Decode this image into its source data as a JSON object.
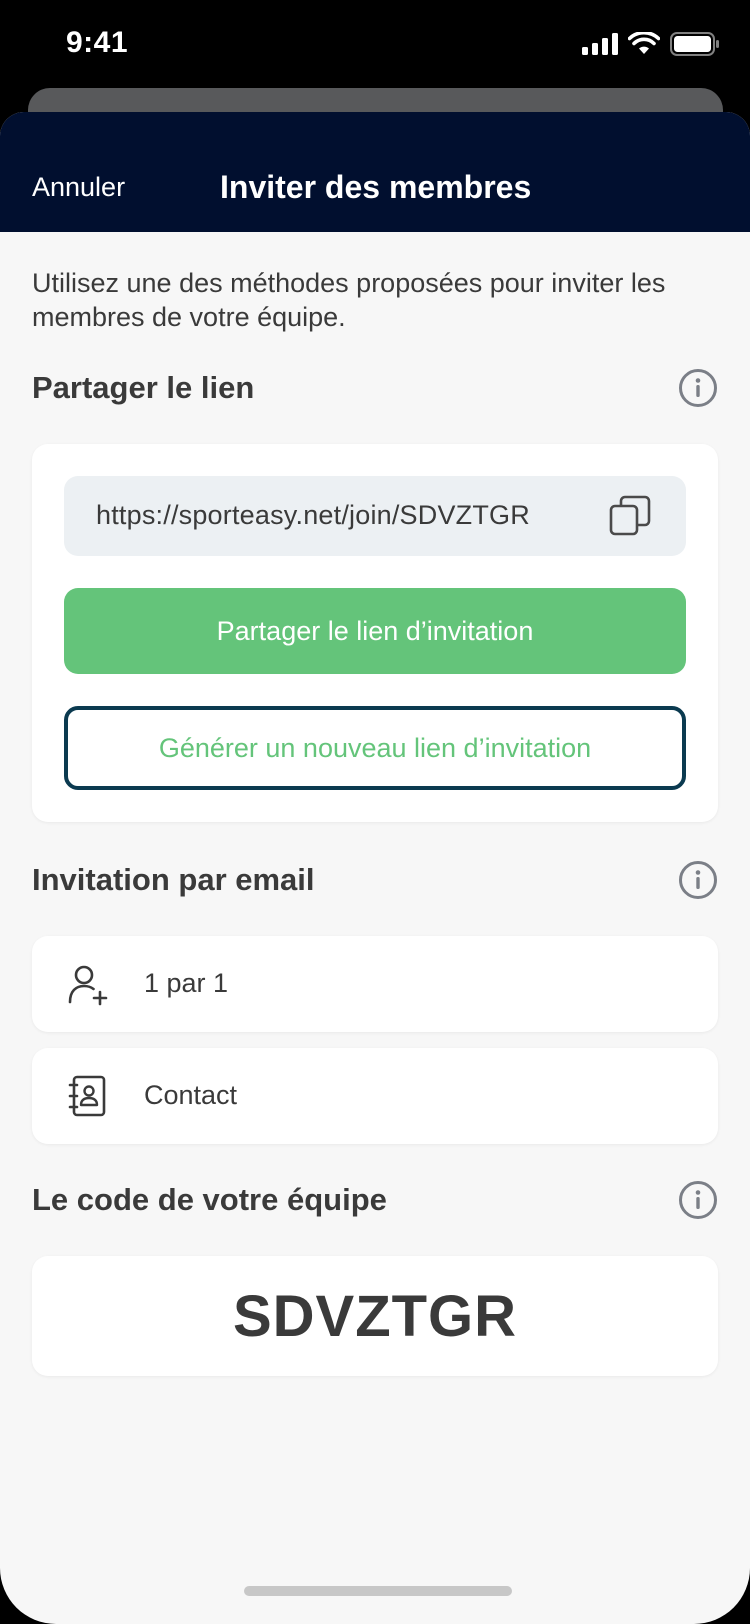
{
  "status_bar": {
    "time": "9:41",
    "icons": [
      "signal-icon",
      "wifi-icon",
      "battery-icon"
    ]
  },
  "nav": {
    "cancel_label": "Annuler",
    "title": "Inviter des membres"
  },
  "intro_text": "Utilisez une des méthodes proposées pour inviter les membres de votre équipe.",
  "share_section": {
    "title": "Partager le lien",
    "link": "https://sporteasy.net/join/SDVZTGR",
    "share_button": "Partager le lien d’invitation",
    "regenerate_button": "Générer un nouveau lien d’invitation"
  },
  "email_section": {
    "title": "Invitation par email",
    "items": [
      {
        "label": "1 par 1",
        "icon": "add-user-icon"
      },
      {
        "label": "Contact",
        "icon": "contact-book-icon"
      }
    ]
  },
  "code_section": {
    "title": "Le code de votre équipe",
    "code": "SDVZTGR"
  },
  "colors": {
    "nav_background": "#010f2f",
    "primary_green": "#64c47a",
    "outline_border": "#0b3a50",
    "page_background": "#f7f7f7",
    "text": "#3a3a3a"
  }
}
